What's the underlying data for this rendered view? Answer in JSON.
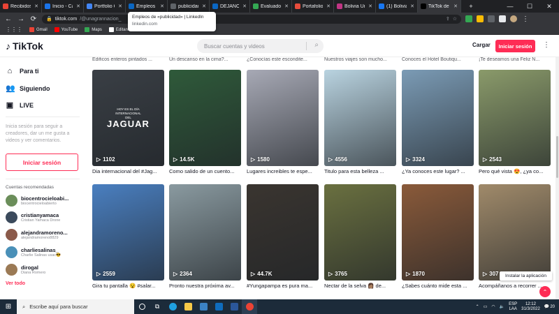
{
  "browser": {
    "tabs": [
      {
        "label": "Recibidos",
        "color": "#ea4335"
      },
      {
        "label": "Inicio - Ca",
        "color": "#1a73e8"
      },
      {
        "label": "Portfolio G",
        "color": "#4285f4"
      },
      {
        "label": "Empleos d",
        "color": "#0a66c2"
      },
      {
        "label": "publicidad",
        "color": "#5f6368"
      },
      {
        "label": "DÉJANOS",
        "color": "#0a66c2"
      },
      {
        "label": "Evaluados",
        "color": "#34a853"
      },
      {
        "label": "Portafolio",
        "color": "#e74c3c"
      },
      {
        "label": "Bolivia Un",
        "color": "#c13584"
      },
      {
        "label": "(1) Bolivia",
        "color": "#1877f2"
      },
      {
        "label": "TikTok de",
        "color": "#000000"
      }
    ],
    "new_tab_icon": "+",
    "address": "tiktok.com",
    "address_path": "/@unagrannacion_",
    "bookmarks": [
      {
        "label": "Gmail",
        "color": "#ea4335"
      },
      {
        "label": "YouTube",
        "color": "#ff0000"
      },
      {
        "label": "Maps",
        "color": "#34a853"
      },
      {
        "label": "Editando cuestiona...",
        "color": "#ffffff"
      }
    ],
    "tooltip": {
      "title": "Empleos de «publicidad» | LinkedIn",
      "url": "linkedin.com"
    }
  },
  "header": {
    "logo": "TikTok",
    "search_placeholder": "Buscar cuentas y videos",
    "upload_label": "Cargar",
    "login_label": "Iniciar sesión"
  },
  "sidebar": {
    "nav": [
      {
        "label": "Para ti",
        "icon": "home-icon"
      },
      {
        "label": "Siguiendo",
        "icon": "following-icon"
      },
      {
        "label": "LIVE",
        "icon": "live-icon"
      }
    ],
    "prompt": "Inicia sesión para seguir a creadores, dar un me gusta a videos y ver comentarios.",
    "login_label": "Iniciar sesión",
    "recommended_title": "Cuentas recomendadas",
    "accounts": [
      {
        "name": "biocentrocieloabi...",
        "sub": "biocentrocieloabierto",
        "color": "#6b8e5a"
      },
      {
        "name": "cristianyamaca",
        "sub": "Cristian Yamaca Drone",
        "color": "#3b4a5c"
      },
      {
        "name": "alejandramoreno...",
        "sub": "alejandramoreno8829",
        "color": "#8b5a4a"
      },
      {
        "name": "charliesalinas_",
        "sub": "Charlie Salinas usac😎",
        "color": "#4a90b8"
      },
      {
        "name": "dirogal",
        "sub": "Diana Romero",
        "color": "#9b7a55"
      }
    ],
    "see_more": "Ver todo"
  },
  "top_captions": [
    "Edificos enteros pintados ...",
    "Un descanso en la cima?...",
    "¿Conocías este escondite...",
    "Nuestros viajes son mucho...",
    "Conoces el Hotel Boutiqu...",
    "¡Te deseamos una Feliz N..."
  ],
  "videos_row1": [
    {
      "count": "1102",
      "caption": "Dia internacional del #Jag...",
      "overlay_small": "HOY ES EL DÍA INTERNACIONAL DEL",
      "overlay_big": "JAGUAR",
      "bg": "#3a3f45"
    },
    {
      "count": "14.5K",
      "caption": "Como salido de un cuento...",
      "bg": "#2f5a3a"
    },
    {
      "count": "1580",
      "caption": "Lugares increibles te espe...",
      "bg": "#a7a9b5"
    },
    {
      "count": "4556",
      "caption": "Titulo para esta belleza ...",
      "bg": "#b9d3e0"
    },
    {
      "count": "3324",
      "caption": "¿Ya conoces este lugar? ...",
      "bg": "#7b9bb5"
    },
    {
      "count": "2543",
      "caption": "Pero qué vista 😍, ¿ya co...",
      "bg": "#8a9a6a"
    }
  ],
  "videos_row2": [
    {
      "count": "2559",
      "caption": "Gira tu pantalla 😵 #salar...",
      "bg": "#4a7fc0"
    },
    {
      "count": "2364",
      "caption": "Pronto nuestra próxima av...",
      "bg": "#8a9aa0"
    },
    {
      "count": "44.7K",
      "caption": "#Yungapampa es pura ma...",
      "bg": "#3a3530"
    },
    {
      "count": "3765",
      "caption": "Nectar de la selva 👩🏽 de...",
      "bg": "#6a7040"
    },
    {
      "count": "1870",
      "caption": "¿Sabes cuánto mide esta ...",
      "bg": "#8a5a3a"
    },
    {
      "count": "307",
      "caption": "Acompáñanos a recorrer ...",
      "bg": "#a08a6a"
    }
  ],
  "install_label": "Instalar la aplicación",
  "taskbar": {
    "search_placeholder": "Escribe aquí para buscar",
    "lang": "ESP",
    "lang2": "LAA",
    "time": "12:12",
    "date": "31/3/2022",
    "notif": "20"
  }
}
